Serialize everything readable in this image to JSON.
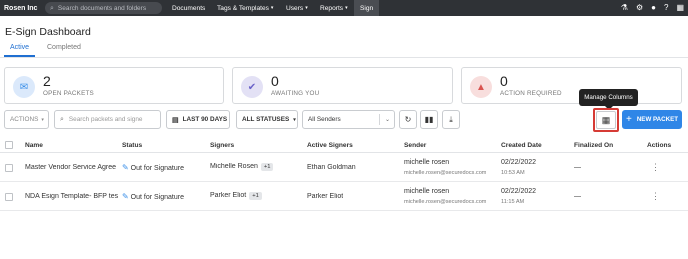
{
  "topbar": {
    "brand": "Rosen Inc",
    "search_placeholder": "Search documents and folders",
    "nav": [
      {
        "label": "Documents"
      },
      {
        "label": "Tags & Templates",
        "caret": "▾"
      },
      {
        "label": "Users",
        "caret": "▾"
      },
      {
        "label": "Reports",
        "caret": "▾"
      },
      {
        "label": "Sign"
      }
    ],
    "icons": [
      "flask-icon",
      "gear-icon",
      "user-icon",
      "help-icon",
      "grid-icon"
    ]
  },
  "page": {
    "title": "E-Sign Dashboard",
    "tabs": [
      "Active",
      "Completed"
    ]
  },
  "cards": [
    {
      "count": "2",
      "label": "OPEN PACKETS",
      "icon": "envelope-icon",
      "color": "#3a8fe8",
      "bg": "#dbe9fb"
    },
    {
      "count": "0",
      "label": "AWAITING YOU",
      "icon": "user-check-icon",
      "color": "#6b63c9",
      "bg": "#e3e1f5"
    },
    {
      "count": "0",
      "label": "ACTION REQUIRED",
      "icon": "warning-icon",
      "color": "#d9534f",
      "bg": "#f8dedd"
    }
  ],
  "toolbar": {
    "actions": "ACTIONS",
    "search_placeholder": "Search packets and signe",
    "date_range": "LAST 90 DAYS",
    "status": "ALL STATUSES",
    "sender": "All Senders",
    "tooltip": "Manage Columns",
    "new_packet": "NEW PACKET"
  },
  "table": {
    "headers": [
      "Name",
      "Status",
      "Signers",
      "Active Signers",
      "Sender",
      "Created Date",
      "Finalized On",
      "Actions"
    ],
    "rows": [
      {
        "name": "Master Vendor Service Agree",
        "status": "Out for Signature",
        "signer": "Michelle Rosen",
        "signer_extra": "+1",
        "active_signer": "Ethan Goldman",
        "sender_name": "michelle rosen",
        "sender_email": "michelle.rosen@securedocs.com",
        "date": "02/22/2022",
        "time": "10:53 AM",
        "finalized": "—"
      },
      {
        "name": "NDA Esign Template- BFP tes",
        "status": "Out for Signature",
        "signer": "Parker Eliot",
        "signer_extra": "+1",
        "active_signer": "Parker Eliot",
        "sender_name": "michelle rosen",
        "sender_email": "michelle.rosen@securedocs.com",
        "date": "02/22/2022",
        "time": "11:15 AM",
        "finalized": "—"
      }
    ]
  }
}
